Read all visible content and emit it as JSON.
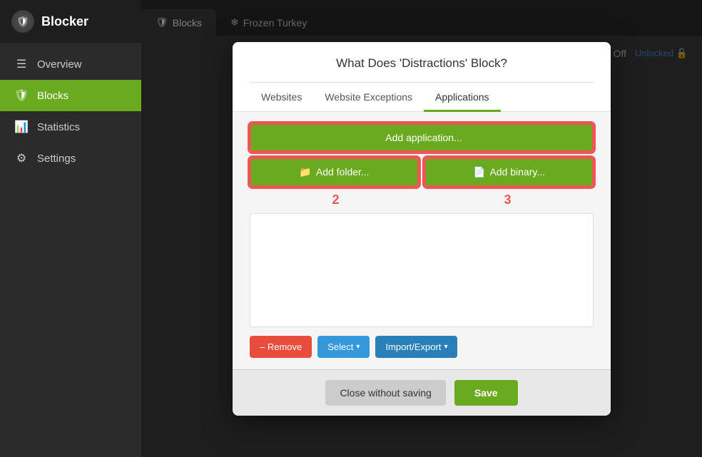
{
  "app": {
    "name": "Blocker",
    "logo": "🛡"
  },
  "sidebar": {
    "items": [
      {
        "id": "overview",
        "label": "Overview",
        "icon": "≡",
        "active": false
      },
      {
        "id": "blocks",
        "label": "Blocks",
        "icon": "🛡",
        "active": true
      },
      {
        "id": "statistics",
        "label": "Statistics",
        "icon": "📊",
        "active": false
      },
      {
        "id": "settings",
        "label": "Settings",
        "icon": "⚙",
        "active": false
      }
    ]
  },
  "tabs": [
    {
      "id": "blocks",
      "label": "Blocks",
      "icon": "🛡",
      "active": true
    },
    {
      "id": "frozen-turkey",
      "label": "Frozen Turkey",
      "icon": "❄",
      "active": false
    }
  ],
  "toolbar": {
    "hamburger": "≡",
    "toggle_state": "Off",
    "unlocked_label": "Unlocked",
    "lock_icon": "🔓"
  },
  "modal": {
    "title": "What Does 'Distractions' Block?",
    "tabs": [
      {
        "id": "websites",
        "label": "Websites",
        "active": false
      },
      {
        "id": "website-exceptions",
        "label": "Website Exceptions",
        "active": false
      },
      {
        "id": "applications",
        "label": "Applications",
        "active": true
      }
    ],
    "add_application_label": "Add application...",
    "add_application_icon": "",
    "add_folder_label": "Add folder...",
    "add_folder_icon": "📁",
    "add_binary_label": "Add binary...",
    "add_binary_icon": "📄",
    "badge_2": "2",
    "badge_3": "3",
    "actions": {
      "remove_label": "– Remove",
      "select_label": "Select",
      "import_export_label": "Import/Export"
    },
    "footer": {
      "close_label": "Close without saving",
      "save_label": "Save"
    }
  }
}
